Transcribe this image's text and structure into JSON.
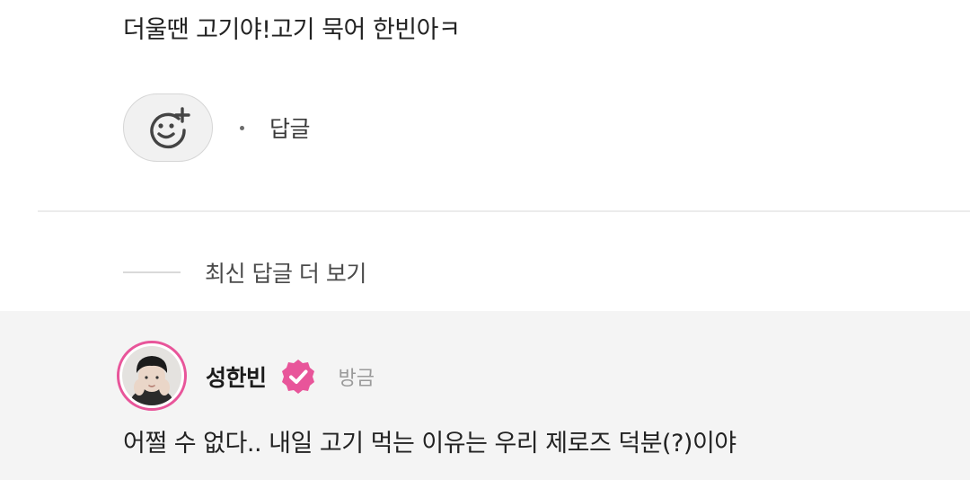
{
  "comment": {
    "text": "더울땐 고기야!고기 묵어 한빈아ㅋ",
    "reaction_icon": "smiley-add-icon",
    "reply_label": "답글"
  },
  "thread": {
    "more_replies_label": "최신 답글 더 보기"
  },
  "reply": {
    "author_name": "성한빈",
    "verified_icon": "verified-badge-icon",
    "timestamp": "방금",
    "text": "어쩔 수 없다.. 내일 고기 먹는 이유는 우리 제로즈 덕분(?)이야",
    "accent_color": "#e8559a"
  }
}
